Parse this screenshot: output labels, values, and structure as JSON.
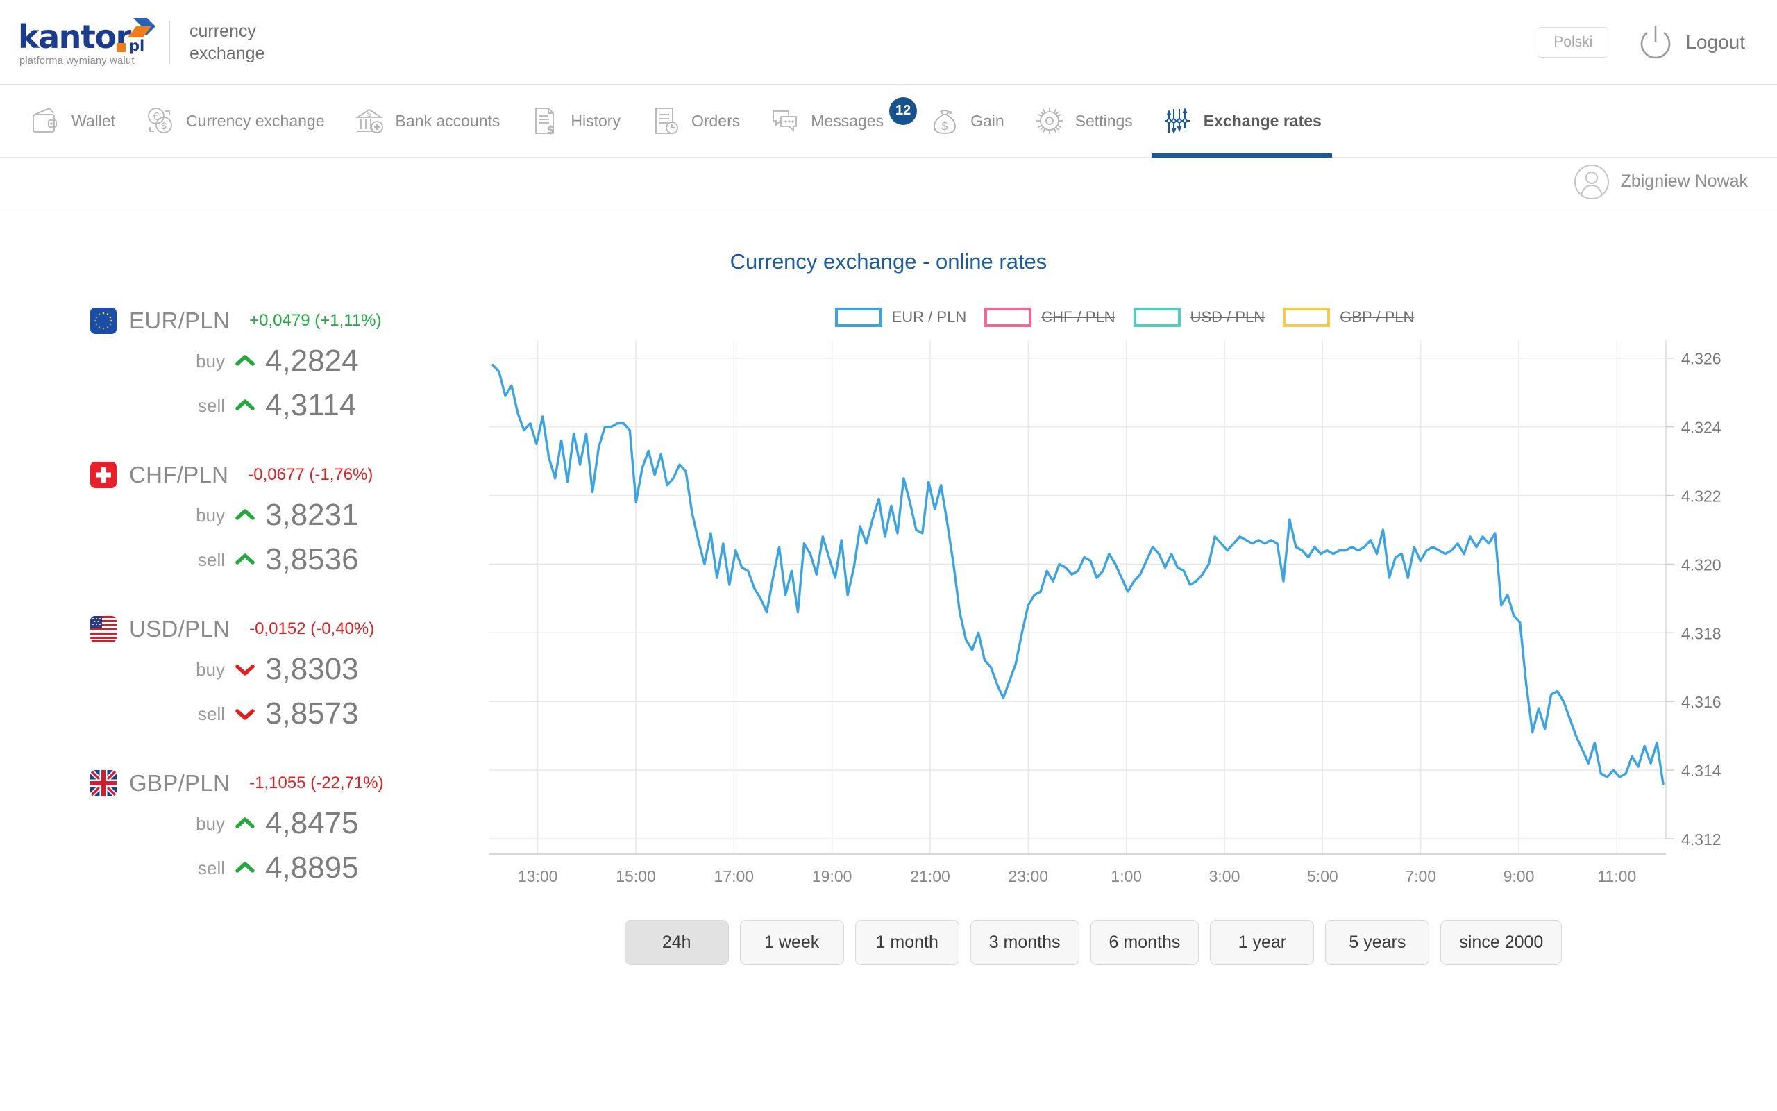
{
  "header": {
    "logo_word": "kantor",
    "logo_pl": "pl",
    "logo_tagline": "platforma wymiany walut",
    "brand_line1": "currency",
    "brand_line2": "exchange",
    "language_button": "Polski",
    "logout_label": "Logout"
  },
  "nav": {
    "items": [
      {
        "label": "Wallet",
        "icon": "wallet-icon",
        "active": false,
        "badge": null
      },
      {
        "label": "Currency exchange",
        "icon": "currency-exchange-icon",
        "active": false,
        "badge": null
      },
      {
        "label": "Bank accounts",
        "icon": "bank-icon",
        "active": false,
        "badge": null
      },
      {
        "label": "History",
        "icon": "document-dollar-icon",
        "active": false,
        "badge": null
      },
      {
        "label": "Orders",
        "icon": "document-clock-icon",
        "active": false,
        "badge": null
      },
      {
        "label": "Messages",
        "icon": "chat-icon",
        "active": false,
        "badge": "12"
      },
      {
        "label": "Gain",
        "icon": "money-bag-icon",
        "active": false,
        "badge": null
      },
      {
        "label": "Settings",
        "icon": "gear-icon",
        "active": false,
        "badge": null
      },
      {
        "label": "Exchange rates",
        "icon": "exchange-rates-icon",
        "active": true,
        "badge": null
      }
    ]
  },
  "user": {
    "name": "Zbigniew Nowak",
    "avatar": "user-avatar-icon"
  },
  "page": {
    "title": "Currency exchange - online rates"
  },
  "rates": [
    {
      "pair": "EUR/PLN",
      "flag": "eu-flag",
      "delta": "+0,0479 (+1,11%)",
      "delta_dir": "up",
      "buy_label": "buy",
      "buy_value": "4,2824",
      "buy_dir": "up",
      "sell_label": "sell",
      "sell_value": "4,3114",
      "sell_dir": "up"
    },
    {
      "pair": "CHF/PLN",
      "flag": "ch-flag",
      "delta": "-0,0677 (-1,76%)",
      "delta_dir": "down",
      "buy_label": "buy",
      "buy_value": "3,8231",
      "buy_dir": "up",
      "sell_label": "sell",
      "sell_value": "3,8536",
      "sell_dir": "up"
    },
    {
      "pair": "USD/PLN",
      "flag": "us-flag",
      "delta": "-0,0152 (-0,40%)",
      "delta_dir": "down",
      "buy_label": "buy",
      "buy_value": "3,8303",
      "buy_dir": "down",
      "sell_label": "sell",
      "sell_value": "3,8573",
      "sell_dir": "down"
    },
    {
      "pair": "GBP/PLN",
      "flag": "gb-flag",
      "delta": "-1,1055 (-22,71%)",
      "delta_dir": "down",
      "buy_label": "buy",
      "buy_value": "4,8475",
      "buy_dir": "up",
      "sell_label": "sell",
      "sell_value": "4,8895",
      "sell_dir": "up"
    }
  ],
  "legend": [
    {
      "label": "EUR / PLN",
      "color": "#3aa3e3",
      "enabled": true
    },
    {
      "label": "CHF / PLN",
      "color": "#f2688f",
      "enabled": false
    },
    {
      "label": "USD / PLN",
      "color": "#4ecdc4",
      "enabled": false
    },
    {
      "label": "GBP / PLN",
      "color": "#f7c948",
      "enabled": false
    }
  ],
  "ranges": [
    {
      "label": "24h",
      "active": true
    },
    {
      "label": "1 week",
      "active": false
    },
    {
      "label": "1 month",
      "active": false
    },
    {
      "label": "3 months",
      "active": false
    },
    {
      "label": "6 months",
      "active": false
    },
    {
      "label": "1 year",
      "active": false
    },
    {
      "label": "5 years",
      "active": false
    },
    {
      "label": "since 2000",
      "active": false
    }
  ],
  "chart_data": {
    "type": "line",
    "title": "Currency exchange - online rates",
    "xlabel": "",
    "ylabel": "",
    "grid": true,
    "legend_position": "top",
    "ylim": [
      4.312,
      4.3265
    ],
    "yticks": [
      4.326,
      4.324,
      4.322,
      4.32,
      4.318,
      4.316,
      4.314,
      4.312
    ],
    "xticks": [
      "13:00",
      "15:00",
      "17:00",
      "19:00",
      "21:00",
      "23:00",
      "1:00",
      "3:00",
      "5:00",
      "7:00",
      "9:00",
      "11:00"
    ],
    "series": [
      {
        "name": "EUR / PLN",
        "color": "#3aa3e3",
        "enabled": true,
        "values": [
          4.3258,
          4.3256,
          4.3249,
          4.3252,
          4.3244,
          4.3239,
          4.3241,
          4.3235,
          4.3243,
          4.3231,
          4.3225,
          4.3236,
          4.3224,
          4.3238,
          4.3229,
          4.3238,
          4.3221,
          4.3234,
          4.324,
          4.324,
          4.3241,
          4.3241,
          4.3239,
          4.3218,
          4.3228,
          4.3233,
          4.3226,
          4.3232,
          4.3223,
          4.3225,
          4.3229,
          4.3227,
          4.3215,
          4.3207,
          4.32,
          4.3209,
          4.3196,
          4.3206,
          4.3194,
          4.3204,
          4.3199,
          4.3198,
          4.3193,
          4.319,
          4.3186,
          4.3196,
          4.3205,
          4.3191,
          4.3198,
          4.3186,
          4.3206,
          4.3203,
          4.3197,
          4.3208,
          4.3202,
          4.3196,
          4.3207,
          4.3191,
          4.3199,
          4.3211,
          4.3206,
          4.3213,
          4.3219,
          4.3208,
          4.3217,
          4.3209,
          4.3225,
          4.3218,
          4.321,
          4.3209,
          4.3224,
          4.3216,
          4.3223,
          4.3212,
          4.32,
          4.3186,
          4.3178,
          4.3175,
          4.318,
          4.3172,
          4.317,
          4.3165,
          4.3161,
          4.3166,
          4.3171,
          4.318,
          4.3188,
          4.3191,
          4.3192,
          4.3198,
          4.3195,
          4.32,
          4.3199,
          4.3197,
          4.3198,
          4.3202,
          4.3201,
          4.3196,
          4.3198,
          4.3203,
          4.32,
          4.3196,
          4.3192,
          4.3195,
          4.3197,
          4.3201,
          4.3205,
          4.3203,
          4.3199,
          4.3203,
          4.3199,
          4.3198,
          4.3194,
          4.3195,
          4.3197,
          4.32,
          4.3208,
          4.3206,
          4.3204,
          4.3206,
          4.3208,
          4.3207,
          4.3206,
          4.3207,
          4.3206,
          4.3207,
          4.3206,
          4.3195,
          4.3213,
          4.3205,
          4.3204,
          4.3202,
          4.3205,
          4.3203,
          4.3204,
          4.3203,
          4.3204,
          4.3204,
          4.3205,
          4.3204,
          4.3205,
          4.3207,
          4.3203,
          4.321,
          4.3196,
          4.3202,
          4.3203,
          4.3196,
          4.3205,
          4.3201,
          4.3204,
          4.3205,
          4.3204,
          4.3203,
          4.3204,
          4.3206,
          4.3203,
          4.3208,
          4.3205,
          4.3208,
          4.3206,
          4.3209,
          4.3188,
          4.3191,
          4.3185,
          4.3183,
          4.3165,
          4.3151,
          4.3158,
          4.3152,
          4.3162,
          4.3163,
          4.316,
          4.3155,
          4.315,
          4.3146,
          4.3142,
          4.3148,
          4.3139,
          4.3138,
          4.314,
          4.3138,
          4.3139,
          4.3144,
          4.3141,
          4.3147,
          4.3142,
          4.3148,
          4.3136
        ]
      }
    ]
  }
}
